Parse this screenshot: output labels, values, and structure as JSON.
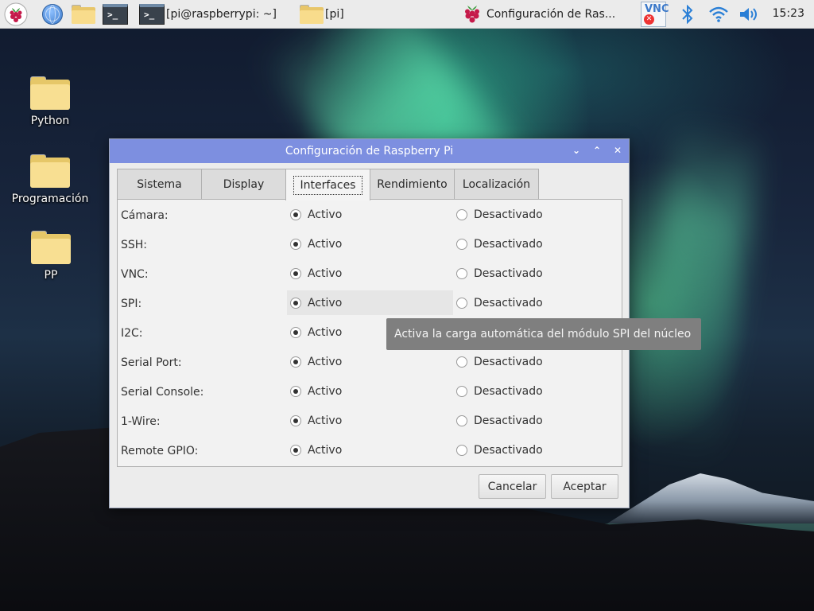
{
  "taskbar": {
    "terminal_task_label": "[pi@raspberrypi: ~]",
    "folder_task_label": "[pi]",
    "config_task_label": "Configuración de Ras...",
    "clock": "15:23",
    "terminal_glyph": ">_"
  },
  "desktop": {
    "icons": [
      {
        "label": "Python"
      },
      {
        "label": "Programación"
      },
      {
        "label": "PP"
      }
    ]
  },
  "dialog": {
    "title": "Configuración de Raspberry Pi",
    "window_controls": {
      "collapse": "⌄",
      "maximize": "⌃",
      "close": "✕"
    },
    "tabs": [
      {
        "label": "Sistema"
      },
      {
        "label": "Display"
      },
      {
        "label": "Interfaces"
      },
      {
        "label": "Rendimiento"
      },
      {
        "label": "Localización"
      }
    ],
    "active_tab": "Interfaces",
    "enabled_label": "Activo",
    "disabled_label": "Desactivado",
    "interfaces": [
      {
        "label": "Cámara:",
        "enabled": true
      },
      {
        "label": "SSH:",
        "enabled": true
      },
      {
        "label": "VNC:",
        "enabled": true
      },
      {
        "label": "SPI:",
        "enabled": true
      },
      {
        "label": "I2C:",
        "enabled": true
      },
      {
        "label": "Serial Port:",
        "enabled": true
      },
      {
        "label": "Serial Console:",
        "enabled": true
      },
      {
        "label": "1-Wire:",
        "enabled": true
      },
      {
        "label": "Remote GPIO:",
        "enabled": true
      }
    ],
    "tooltip": "Activa la carga automática del módulo SPI del núcleo",
    "buttons": {
      "cancel": "Cancelar",
      "ok": "Aceptar"
    }
  },
  "colors": {
    "titlebar": "#7d8fe0",
    "tooltip_bg": "#7f7f7f",
    "taskbar_bg": "#ebebeb"
  }
}
